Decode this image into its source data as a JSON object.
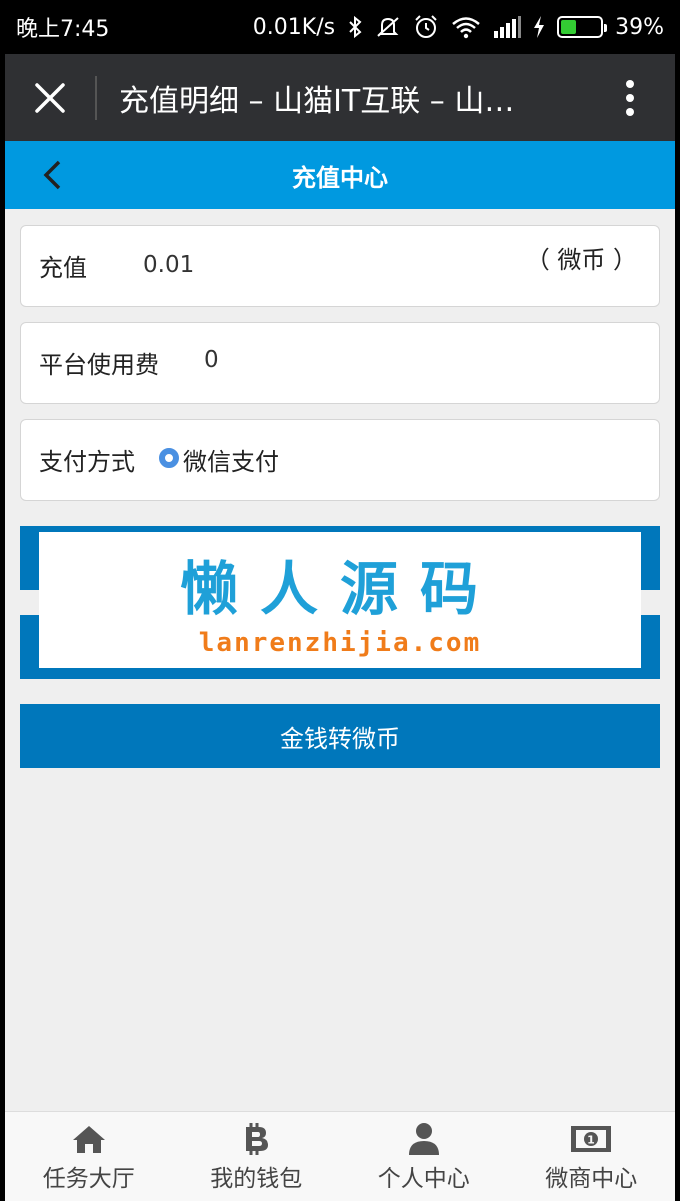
{
  "status_bar": {
    "time": "晚上7:45",
    "speed": "0.01K/s",
    "battery_text": "39%",
    "battery_level": 0.39
  },
  "titlebar": {
    "title": "充值明细 – 山猫IT互联 – 山…"
  },
  "header": {
    "title": "充值中心"
  },
  "recharge": {
    "label": "充值",
    "value": "0.01",
    "unit": "（ 微币 ）"
  },
  "fee": {
    "label": "平台使用费",
    "value": "0"
  },
  "payment": {
    "label": "支付方式",
    "option": "微信支付"
  },
  "buttons": {
    "convert": "金钱转微币"
  },
  "watermark": {
    "cn": "懒人源码",
    "en": "lanrenzhijia.com"
  },
  "bottom_nav": [
    {
      "label": "任务大厅",
      "icon": "home-icon"
    },
    {
      "label": "我的钱包",
      "icon": "bitcoin-icon"
    },
    {
      "label": "个人中心",
      "icon": "user-icon"
    },
    {
      "label": "微商中心",
      "icon": "money-icon"
    }
  ],
  "colors": {
    "header": "#0099e0",
    "button": "#0077bb",
    "titlebar": "#2f3033"
  }
}
